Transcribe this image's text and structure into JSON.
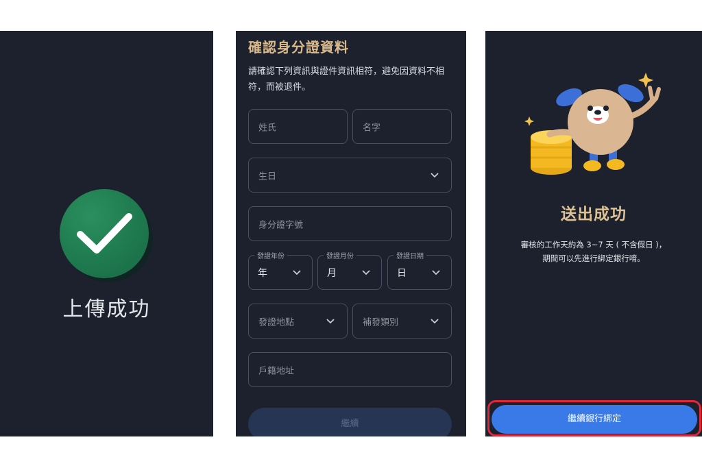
{
  "upload_screen": {
    "status_text": "上傳成功"
  },
  "id_form": {
    "title": "確認身分證資料",
    "description": "請確認下列資訊與證件資訊相符，避免因資料不相符，而被退件。",
    "last_name_placeholder": "姓氏",
    "first_name_placeholder": "名字",
    "birthday_placeholder": "生日",
    "id_number_placeholder": "身分證字號",
    "issue_year": {
      "legend": "發證年份",
      "value": "年"
    },
    "issue_month": {
      "legend": "發證月份",
      "value": "月"
    },
    "issue_day": {
      "legend": "發證日期",
      "value": "日"
    },
    "issue_place_placeholder": "發證地點",
    "issue_type_placeholder": "補發類別",
    "household_address_placeholder": "戶籍地址",
    "submit_label": "繼續"
  },
  "success_screen": {
    "title": "送出成功",
    "desc_line1": "審核的工作天約為 3~7 天 ( 不含假日 )，",
    "desc_line2": "期間可以先進行綁定銀行唷。",
    "continue_label": "繼續銀行綁定"
  },
  "colors": {
    "panel_bg": "#1c212d",
    "accent_gold": "#d9b98a",
    "check_green": "#1f7a4f",
    "button_blue": "#3a7ae8",
    "highlight_red": "#e0283a"
  }
}
